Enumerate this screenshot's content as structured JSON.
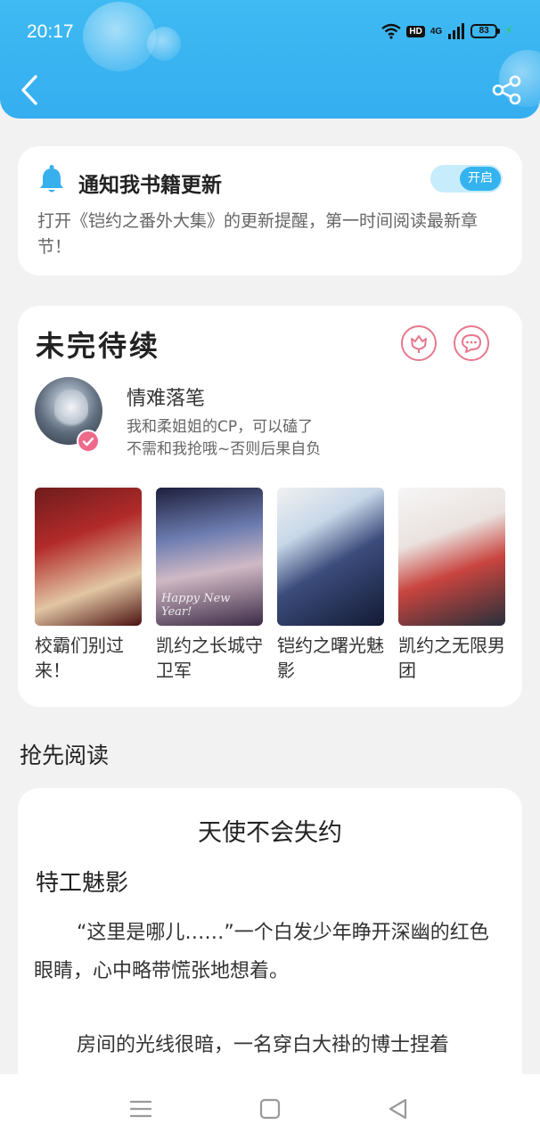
{
  "status_bar": {
    "time": "20:17",
    "hd": "HD",
    "network": "4G",
    "battery": "83"
  },
  "header": {
    "back_icon": "chevron-left-icon",
    "share_icon": "share-icon",
    "color": "#35aef0"
  },
  "notify": {
    "title": "通知我书籍更新",
    "toggle_label": "开启",
    "toggle_on": true,
    "description": "打开《铠约之番外大集》的更新提醒，第一时间阅读最新章节！"
  },
  "unfinished": {
    "title": "未完待续",
    "author": {
      "name": "情难落笔",
      "bio_line1": "我和柔姐姐的CP，可以磕了",
      "bio_line2": "不需和我抢哦~否则后果自负"
    },
    "books": [
      {
        "title": "校霸们别过来！"
      },
      {
        "title": "凯约之长城守卫军",
        "cover_text": "Happy New Year!"
      },
      {
        "title": "铠约之曙光魅影"
      },
      {
        "title": "凯约之无限男团"
      }
    ]
  },
  "preview": {
    "section_title": "抢先阅读",
    "book_name": "天使不会失约",
    "chapter_name": "特工魅影",
    "paragraph1": "“这里是哪儿……”一个白发少年睁开深幽的红色眼睛，心中略带慌张地想着。",
    "paragraph2": "房间的光线很暗，一名穿白大褂的博士捏着"
  },
  "accent_pink": "#e7778e"
}
